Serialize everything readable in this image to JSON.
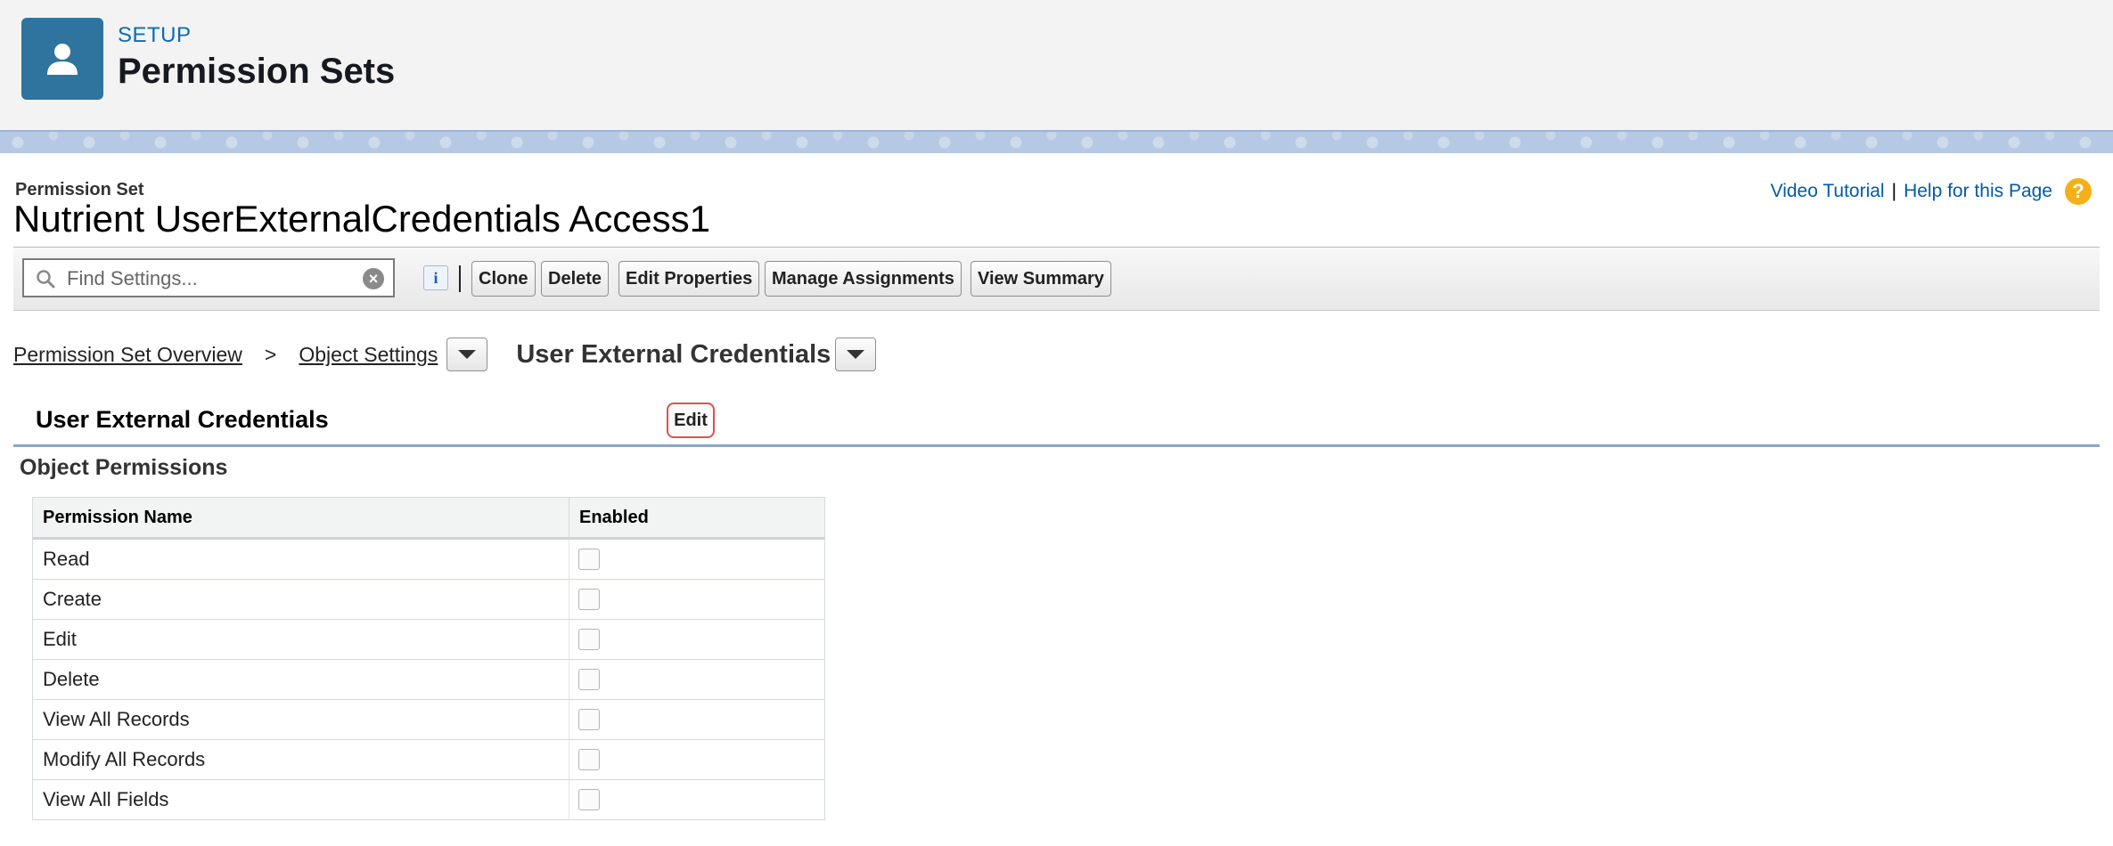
{
  "header": {
    "eyebrow": "SETUP",
    "title": "Permission Sets",
    "icon": "user-icon"
  },
  "record": {
    "type_label": "Permission Set",
    "name": "Nutrient UserExternalCredentials Access1"
  },
  "help_links": {
    "video_tutorial": "Video Tutorial",
    "separator": "|",
    "help_page": "Help for this Page",
    "help_icon_glyph": "?"
  },
  "toolbar": {
    "search_placeholder": "Find Settings...",
    "info_glyph": "i",
    "clear_glyph": "×",
    "buttons": {
      "clone": "Clone",
      "delete": "Delete",
      "edit_properties": "Edit Properties",
      "manage_assignments": "Manage Assignments",
      "view_summary": "View Summary"
    }
  },
  "breadcrumb": {
    "overview": "Permission Set Overview",
    "separator": ">",
    "object_settings": "Object Settings",
    "current": "User External Credentials"
  },
  "section": {
    "title": "User External Credentials",
    "edit_label": "Edit",
    "subsection_title": "Object Permissions"
  },
  "table": {
    "headers": {
      "name": "Permission Name",
      "enabled": "Enabled"
    },
    "rows": [
      {
        "name": "Read",
        "enabled": false
      },
      {
        "name": "Create",
        "enabled": false
      },
      {
        "name": "Edit",
        "enabled": false
      },
      {
        "name": "Delete",
        "enabled": false
      },
      {
        "name": "View All Records",
        "enabled": false
      },
      {
        "name": "Modify All Records",
        "enabled": false
      },
      {
        "name": "View All Fields",
        "enabled": false
      }
    ]
  },
  "colors": {
    "brand_tile": "#2e749e",
    "link": "#015ba7",
    "setup_label": "#0b6cb3",
    "help_icon": "#f4b018",
    "edit_highlight": "#d9534f"
  }
}
